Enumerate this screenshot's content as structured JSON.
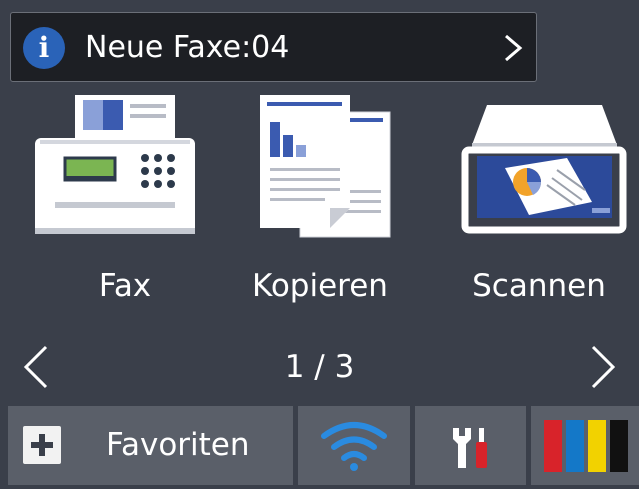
{
  "notification": {
    "text": "Neue Faxe:04",
    "icon": "info-icon",
    "accent": "#2a63b8"
  },
  "apps": [
    {
      "label": "Fax",
      "icon": "fax-icon"
    },
    {
      "label": "Kopieren",
      "icon": "copy-icon"
    },
    {
      "label": "Scannen",
      "icon": "scanner-icon"
    }
  ],
  "pager": {
    "text": "1 / 3"
  },
  "bottom_bar": {
    "favorites_label": "Favoriten",
    "wifi_icon": "wifi-icon",
    "tools_icon": "tools-icon",
    "ink_icon": "ink-icon",
    "ink_colors": [
      "#d8232a",
      "#1478c8",
      "#f2d200",
      "#111111"
    ]
  }
}
